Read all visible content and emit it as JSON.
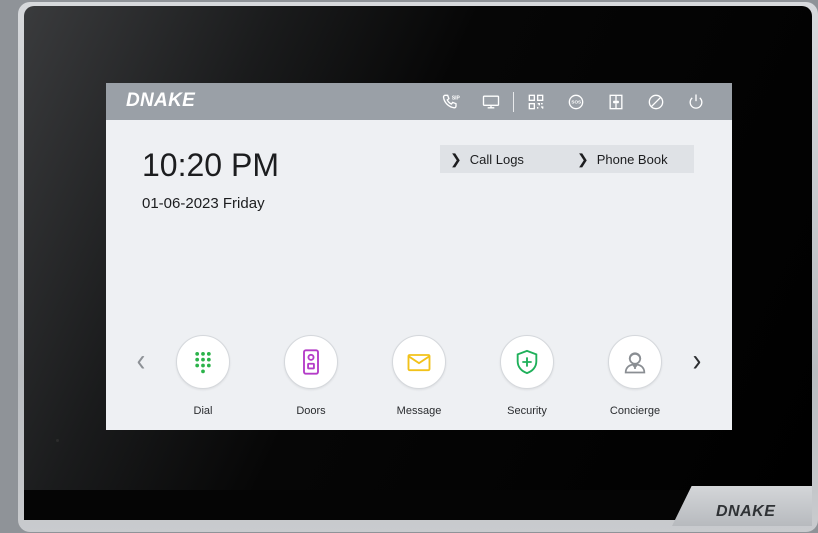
{
  "device": {
    "bezel_logo": "DNAKE"
  },
  "topbar": {
    "logo": "DNAKE",
    "icons": [
      "sip-call-icon",
      "monitor-icon",
      "qr-code-icon",
      "sos-icon",
      "door-status-icon",
      "do-not-disturb-icon",
      "power-icon"
    ]
  },
  "main": {
    "time": "10:20 PM",
    "date": "01-06-2023 Friday"
  },
  "quicklinks": [
    {
      "label": "Call Logs"
    },
    {
      "label": "Phone Book"
    }
  ],
  "apps": [
    {
      "label": "Dial",
      "color": "#2bb34a"
    },
    {
      "label": "Doors",
      "color": "#b43cc8"
    },
    {
      "label": "Message",
      "color": "#f2c21a"
    },
    {
      "label": "Security",
      "color": "#1fb05a"
    },
    {
      "label": "Concierge",
      "color": "#8a8e93"
    }
  ],
  "colors": {
    "topbar": "#9aa0a7",
    "screen_bg": "#eef0f3"
  }
}
